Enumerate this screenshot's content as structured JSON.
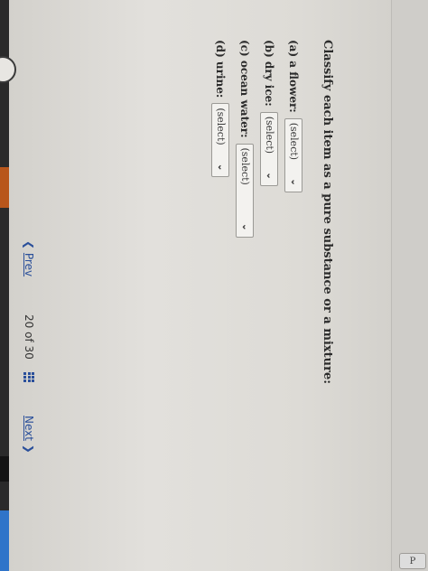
{
  "question": {
    "title": "Classify each item as a pure substance or a mixture:",
    "items": [
      {
        "label": "(a) a flower:",
        "select_value": "(select)"
      },
      {
        "label": "(b) dry ice:",
        "select_value": "(select)"
      },
      {
        "label": "(c) ocean water:",
        "select_value": "(select)"
      },
      {
        "label": "(d) urine:",
        "select_value": "(select)"
      }
    ]
  },
  "navigation": {
    "prev_label": "Prev",
    "page_current": "20",
    "page_separator": "of",
    "page_total": "30",
    "next_label": "Next"
  },
  "right_edge": {
    "button_label": "P"
  },
  "colors": {
    "link": "#2a4f9a",
    "text": "#2b2b2b",
    "border": "#9b9a96"
  }
}
